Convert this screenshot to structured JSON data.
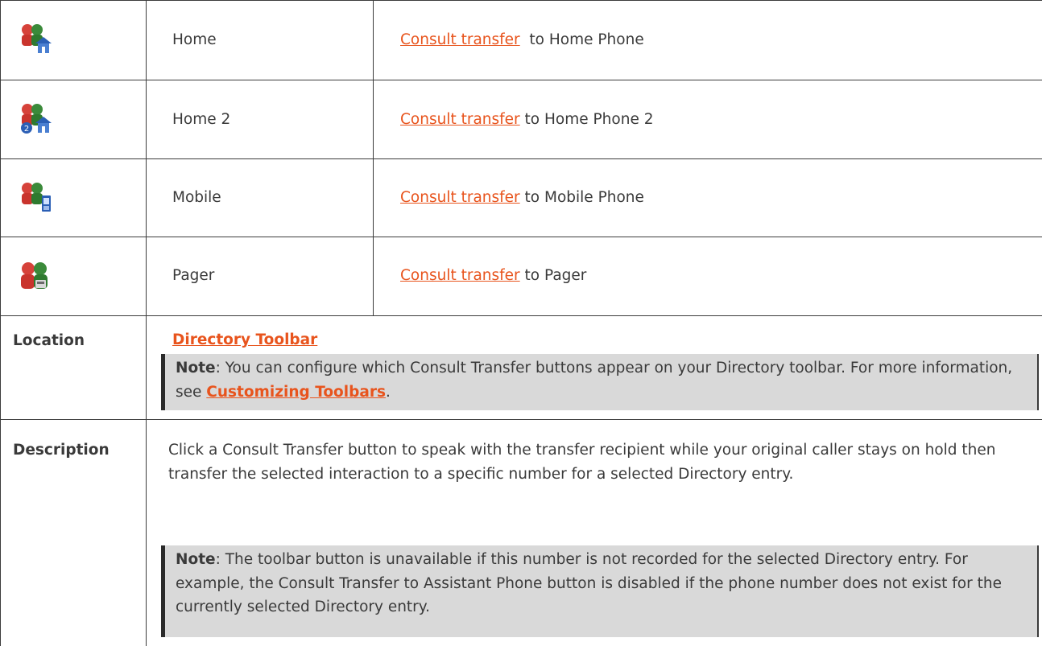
{
  "rows": [
    {
      "name": "Home",
      "link": "Consult transfer",
      "suffix": "  to Home Phone",
      "icon": "consult-transfer-home-icon"
    },
    {
      "name": "Home 2",
      "link": "Consult transfer",
      "suffix": " to Home Phone 2",
      "icon": "consult-transfer-home2-icon"
    },
    {
      "name": "Mobile",
      "link": "Consult transfer",
      "suffix": " to Mobile Phone",
      "icon": "consult-transfer-mobile-icon"
    },
    {
      "name": "Pager",
      "link": "Consult transfer",
      "suffix": " to Pager",
      "icon": "consult-transfer-pager-icon"
    }
  ],
  "location": {
    "label": "Location",
    "link": "Directory Toolbar",
    "note_label": "Note",
    "note_text": ": You can configure which Consult Transfer buttons appear on your Directory toolbar. For more information, see ",
    "note_link": "Customizing Toolbars",
    "note_end": "."
  },
  "description": {
    "label": "Description",
    "text": "Click a Consult Transfer button to speak with the transfer recipient while your original caller stays on hold then transfer the selected interaction to a specific number for a selected Directory entry.",
    "note_label": "Note",
    "note_text": ": The toolbar button is unavailable if this number is not recorded for the selected Directory entry. For example, the Consult Transfer to Assistant Phone button is disabled if the phone number does not exist for the currently selected Directory entry."
  },
  "colors": {
    "link": "#e8541d",
    "note_bg": "#d9d9d9",
    "border": "#3c3c3c"
  }
}
